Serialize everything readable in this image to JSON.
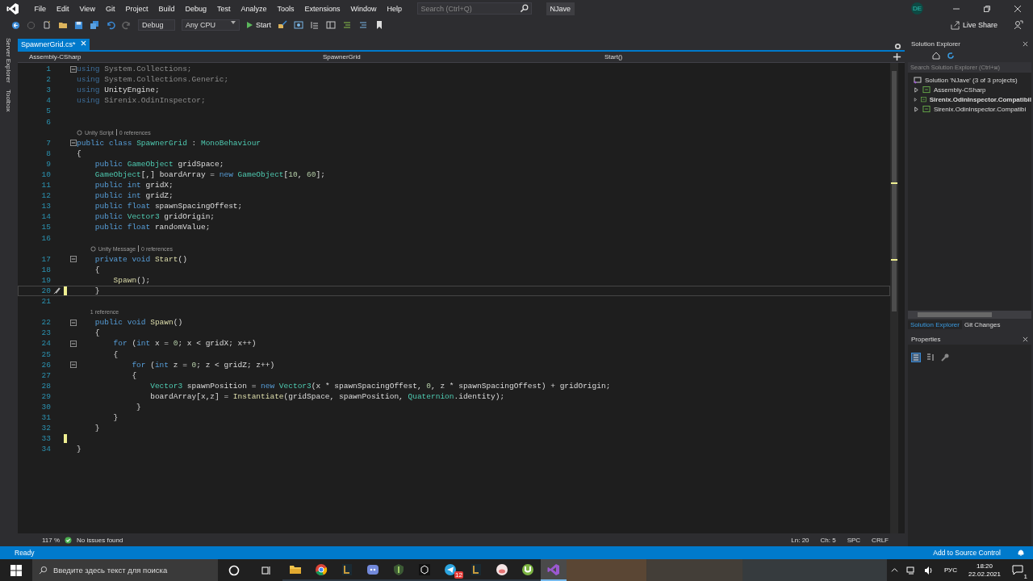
{
  "window": {
    "menu": [
      "File",
      "Edit",
      "View",
      "Git",
      "Project",
      "Build",
      "Debug",
      "Test",
      "Analyze",
      "Tools",
      "Extensions",
      "Window",
      "Help"
    ],
    "search": {
      "placeholder": "Search (Ctrl+Q)"
    },
    "solution_name": "NJave",
    "account": "DE",
    "live_share": "Live Share"
  },
  "toolbar": {
    "configuration": "Debug",
    "platform": "Any CPU",
    "start": "Start"
  },
  "side_tabs": [
    "Server Explorer",
    "Toolbox"
  ],
  "document_tabs": [
    {
      "label": "SpawnerGrid.cs*",
      "selected": true
    }
  ],
  "navigation": {
    "project": "Assembly-CSharp",
    "type": "SpawnerGrid",
    "member": "Start()"
  },
  "editor": {
    "lines": [
      {
        "number": "1",
        "fold": true,
        "tokens": [
          {
            "kind": "kwdim",
            "text": "using "
          },
          {
            "kind": "dim",
            "text": "System.Collections;"
          }
        ]
      },
      {
        "number": "2",
        "tokens": [
          {
            "kind": "kwdim",
            "text": "using "
          },
          {
            "kind": "dim",
            "text": "System.Collections.Generic;"
          }
        ]
      },
      {
        "number": "3",
        "tokens": [
          {
            "kind": "kwdim",
            "text": "using "
          },
          {
            "kind": "p",
            "text": "UnityEngine;"
          }
        ]
      },
      {
        "number": "4",
        "tokens": [
          {
            "kind": "kwdim",
            "text": "using "
          },
          {
            "kind": "dim",
            "text": "Sirenix.OdinInspector;"
          }
        ]
      },
      {
        "number": "5"
      },
      {
        "number": "6"
      },
      {
        "number": "7",
        "fold": true,
        "lens": {
          "kind": "unity",
          "parts": [
            "Unity Script",
            "0 references"
          ]
        },
        "tokens": [
          {
            "kind": "kw",
            "text": "public class "
          },
          {
            "kind": "type",
            "text": "SpawnerGrid"
          },
          {
            "kind": "p",
            "text": " : "
          },
          {
            "kind": "type",
            "text": "MonoBehaviour"
          }
        ]
      },
      {
        "number": "8",
        "tokens": [
          {
            "kind": "p",
            "text": "{"
          }
        ]
      },
      {
        "number": "9",
        "tokens": [
          {
            "kind": "kw",
            "text": "    public "
          },
          {
            "kind": "type",
            "text": "GameObject"
          },
          {
            "kind": "p",
            "text": " gridSpace;"
          }
        ]
      },
      {
        "number": "10",
        "tokens": [
          {
            "kind": "type",
            "text": "    GameObject"
          },
          {
            "kind": "p",
            "text": "[,] boardArray = "
          },
          {
            "kind": "kw",
            "text": "new "
          },
          {
            "kind": "type",
            "text": "GameObject"
          },
          {
            "kind": "p",
            "text": "["
          },
          {
            "kind": "num",
            "text": "10"
          },
          {
            "kind": "p",
            "text": ", "
          },
          {
            "kind": "num",
            "text": "60"
          },
          {
            "kind": "p",
            "text": "];"
          }
        ]
      },
      {
        "number": "11",
        "tokens": [
          {
            "kind": "kw",
            "text": "    public int"
          },
          {
            "kind": "p",
            "text": " gridX;"
          }
        ]
      },
      {
        "number": "12",
        "tokens": [
          {
            "kind": "kw",
            "text": "    public int"
          },
          {
            "kind": "p",
            "text": " gridZ;"
          }
        ]
      },
      {
        "number": "13",
        "tokens": [
          {
            "kind": "kw",
            "text": "    public float"
          },
          {
            "kind": "p",
            "text": " spawnSpacingOffest;"
          }
        ]
      },
      {
        "number": "14",
        "tokens": [
          {
            "kind": "kw",
            "text": "    public "
          },
          {
            "kind": "type",
            "text": "Vector3"
          },
          {
            "kind": "p",
            "text": " gridOrigin;"
          }
        ]
      },
      {
        "number": "15",
        "tokens": [
          {
            "kind": "kw",
            "text": "    public float"
          },
          {
            "kind": "p",
            "text": " randomValue;"
          }
        ]
      },
      {
        "number": "16"
      },
      {
        "number": "17",
        "fold": true,
        "lens": {
          "kind": "unity",
          "parts": [
            "Unity Message",
            "0 references"
          ]
        },
        "tokens": [
          {
            "kind": "kw",
            "text": "    private void "
          },
          {
            "kind": "method",
            "text": "Start"
          },
          {
            "kind": "p",
            "text": "()"
          }
        ]
      },
      {
        "number": "18",
        "tokens": [
          {
            "kind": "p",
            "text": "    {"
          }
        ]
      },
      {
        "number": "19",
        "tokens": [
          {
            "kind": "method",
            "text": "        Spawn"
          },
          {
            "kind": "p",
            "text": "();"
          }
        ]
      },
      {
        "number": "20",
        "current": true,
        "modified": true,
        "tokens": [
          {
            "kind": "p",
            "text": "    }"
          }
        ]
      },
      {
        "number": "21"
      },
      {
        "number": "22",
        "fold": true,
        "lens": {
          "kind": "refs",
          "parts": [
            "1 reference"
          ]
        },
        "tokens": [
          {
            "kind": "kw",
            "text": "    public void "
          },
          {
            "kind": "method",
            "text": "Spawn"
          },
          {
            "kind": "p",
            "text": "()"
          }
        ]
      },
      {
        "number": "23",
        "tokens": [
          {
            "kind": "p",
            "text": "    {"
          }
        ]
      },
      {
        "number": "24",
        "fold": true,
        "tokens": [
          {
            "kind": "kw",
            "text": "        for"
          },
          {
            "kind": "p",
            "text": " ("
          },
          {
            "kind": "kw",
            "text": "int"
          },
          {
            "kind": "p",
            "text": " x = "
          },
          {
            "kind": "num",
            "text": "0"
          },
          {
            "kind": "p",
            "text": "; x < gridX; x++)"
          }
        ]
      },
      {
        "number": "25",
        "tokens": [
          {
            "kind": "p",
            "text": "        {"
          }
        ]
      },
      {
        "number": "26",
        "fold": true,
        "tokens": [
          {
            "kind": "kw",
            "text": "            for"
          },
          {
            "kind": "p",
            "text": " ("
          },
          {
            "kind": "kw",
            "text": "int"
          },
          {
            "kind": "p",
            "text": " z = "
          },
          {
            "kind": "num",
            "text": "0"
          },
          {
            "kind": "p",
            "text": "; z < gridZ; z++)"
          }
        ]
      },
      {
        "number": "27",
        "tokens": [
          {
            "kind": "p",
            "text": "            {"
          }
        ]
      },
      {
        "number": "28",
        "tokens": [
          {
            "kind": "type",
            "text": "                Vector3"
          },
          {
            "kind": "p",
            "text": " spawnPosition = "
          },
          {
            "kind": "kw",
            "text": "new "
          },
          {
            "kind": "type",
            "text": "Vector3"
          },
          {
            "kind": "p",
            "text": "(x * spawnSpacingOffest, "
          },
          {
            "kind": "num",
            "text": "0"
          },
          {
            "kind": "p",
            "text": ", z * spawnSpacingOffest) + gridOrigin;"
          }
        ]
      },
      {
        "number": "29",
        "tokens": [
          {
            "kind": "p",
            "text": "                boardArray[x,z] = "
          },
          {
            "kind": "method",
            "text": "Instantiate"
          },
          {
            "kind": "p",
            "text": "(gridSpace, spawnPosition, "
          },
          {
            "kind": "type",
            "text": "Quaternion"
          },
          {
            "kind": "p",
            "text": ".identity);"
          }
        ]
      },
      {
        "number": "30",
        "tokens": [
          {
            "kind": "p",
            "text": "             }"
          }
        ]
      },
      {
        "number": "31",
        "tokens": [
          {
            "kind": "p",
            "text": "        }"
          }
        ]
      },
      {
        "number": "32",
        "tokens": [
          {
            "kind": "p",
            "text": "    }"
          }
        ]
      },
      {
        "number": "33",
        "modified": true
      },
      {
        "number": "34",
        "tokens": [
          {
            "kind": "p",
            "text": "}"
          }
        ]
      }
    ]
  },
  "editor_status": {
    "zoom": "117 %",
    "issues": "No issues found",
    "line": "Ln: 20",
    "column": "Ch: 5",
    "indent": "SPC",
    "line_ending": "CRLF"
  },
  "solution_explorer": {
    "title": "Solution Explorer",
    "search": {
      "placeholder": "Search Solution Explorer (Ctrl+ж)"
    },
    "tree": [
      {
        "label": "Solution 'NJave' (3 of 3 projects)",
        "children": [
          {
            "label": "Assembly-CSharp",
            "expanded": false,
            "startup": false
          },
          {
            "label": "Sirenix.OdinInspector.Compatibil",
            "expanded": false,
            "startup": true
          },
          {
            "label": "Sirenix.OdinInspector.Compatibi",
            "expanded": false,
            "startup": false
          }
        ]
      }
    ]
  },
  "panel_tabs": [
    {
      "label": "Solution Explorer",
      "selected": true
    },
    {
      "label": "Git Changes",
      "selected": false
    }
  ],
  "properties": {
    "title": "Properties"
  },
  "status_bar": {
    "text": "Ready",
    "source_control": "Add to Source Control"
  },
  "taskbar": {
    "search": {
      "placeholder": "Введите здесь текст для поиска"
    },
    "apps": [
      {
        "selected": false
      },
      {
        "selected": false
      },
      {
        "selected": false
      },
      {
        "selected": false
      },
      {
        "selected": false
      },
      {
        "selected": false
      },
      {
        "selected": false,
        "badge": "12"
      },
      {
        "selected": false
      },
      {
        "selected": false
      },
      {
        "selected": false
      },
      {
        "selected": true
      }
    ],
    "language": "РУС",
    "time": "18:20",
    "date": "22.02.2021",
    "notifications": "1"
  }
}
